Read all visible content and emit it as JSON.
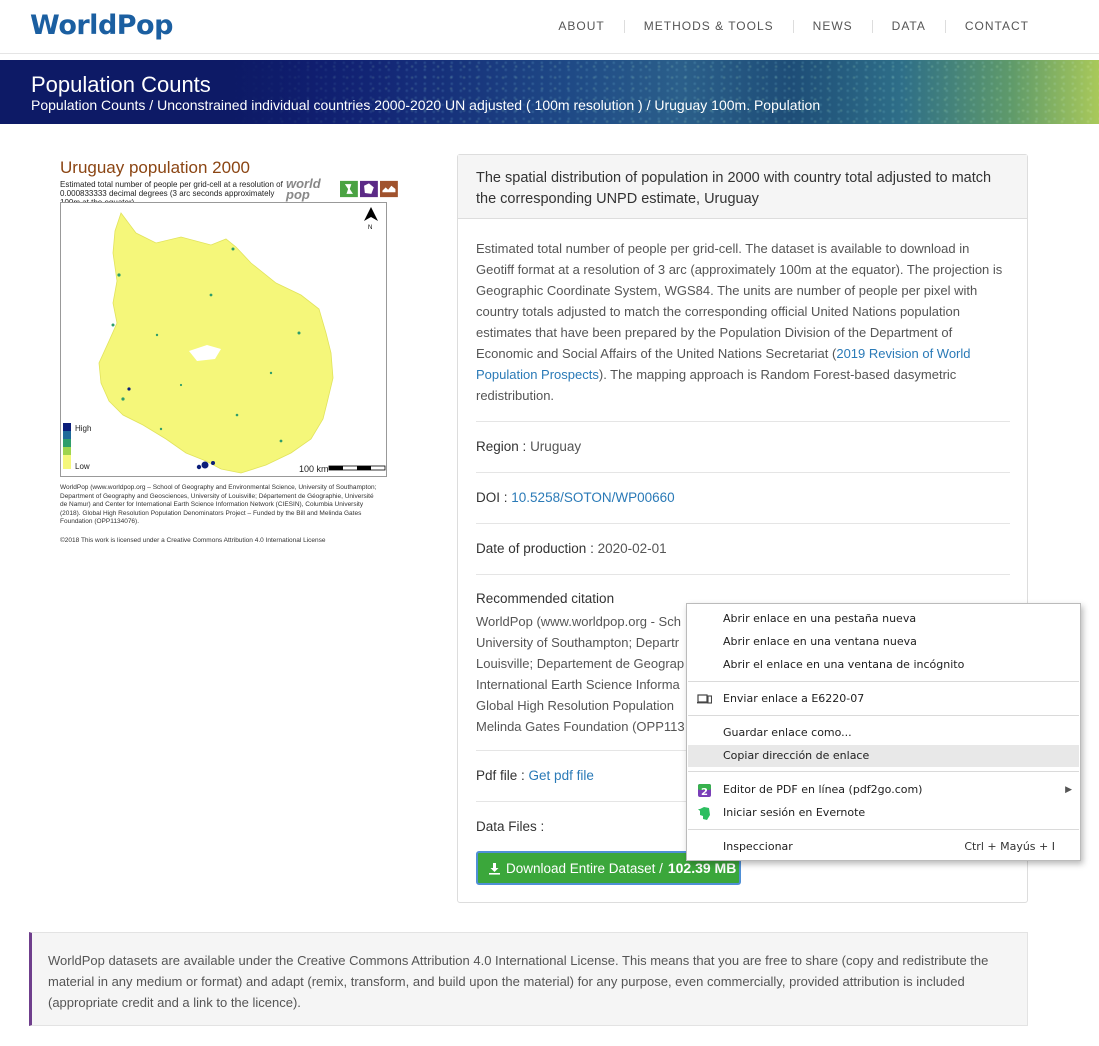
{
  "header": {
    "logo": "WorldPop",
    "nav": [
      "ABOUT",
      "METHODS & TOOLS",
      "NEWS",
      "DATA",
      "CONTACT"
    ]
  },
  "banner": {
    "title": "Population Counts",
    "breadcrumb": "Population Counts / Unconstrained individual countries 2000-2020 UN adjusted ( 100m resolution ) / Uruguay 100m. Population"
  },
  "figure": {
    "title": "Uruguay population 2000",
    "subtitle": "Estimated total number of people per grid-cell at a resolution of 0.000833333 decimal degrees (3 arc seconds approximately 100m at the equator)",
    "logo_text": "world pop",
    "north": "N",
    "legend_high": "High",
    "legend_low": "Low",
    "scale": "100 km",
    "credit": "WorldPop (www.worldpop.org – School of Geography and Environmental Science, University of Southampton; Department of Geography and Geosciences, University of Louisville; Département de Géographie, Université de Namur) and Center for International Earth Science Information Network (CIESIN), Columbia University (2018). Global High Resolution Population Denominators Project – Funded by the Bill and Melinda Gates Foundation (OPP1134076).",
    "license": "©2018 This work is licensed under a Creative Commons Attribution 4.0 International License",
    "colors": {
      "low": "#f5f77a",
      "high": "#0b1e7a",
      "mid": "#2f9d6b"
    }
  },
  "panel": {
    "heading": "The spatial distribution of population in 2000 with country total adjusted to match the corresponding UNPD estimate, Uruguay",
    "description_before": "Estimated total number of people per grid-cell. The dataset is available to download in Geotiff format at a resolution of 3 arc (approximately 100m at the equator). The projection is Geographic Coordinate System, WGS84. The units are number of people per pixel with country totals adjusted to match the corresponding official United Nations population estimates that have been prepared by the Population Division of the Department of Economic and Social Affairs of the United Nations Secretariat (",
    "description_link": "2019 Revision of World Population Prospects",
    "description_after": "). The mapping approach is Random Forest-based dasymetric redistribution.",
    "region_label": "Region :",
    "region_value": "Uruguay",
    "doi_label": "DOI :",
    "doi_value": "10.5258/SOTON/WP00660",
    "date_label": "Date of production :",
    "date_value": "2020-02-01",
    "citation_label": "Recommended citation",
    "citation_lines": [
      "WorldPop (www.worldpop.org - Sch",
      "University of Southampton; Departr",
      "Louisville; Departement de Geograp",
      "International Earth Science Informa",
      "Global High Resolution Population",
      "Melinda Gates Foundation (OPP113"
    ],
    "pdf_label": "Pdf file :",
    "pdf_link": "Get pdf file",
    "data_files_label": "Data Files :",
    "download_label": "Download Entire Dataset /",
    "download_size": "102.39 MB",
    "accent_color": "#3ba73b"
  },
  "license_box": {
    "text": "WorldPop datasets are available under the Creative Commons Attribution 4.0 International License. This means that you are free to share (copy and redistribute the material in any medium or format) and adapt (remix, transform, and build upon the material) for any purpose, even commercially, provided attribution is included (appropriate credit and a link to the licence)."
  },
  "context_menu": {
    "items": [
      {
        "label": "Abrir enlace en una pestaña nueva"
      },
      {
        "label": "Abrir enlace en una ventana nueva"
      },
      {
        "label": "Abrir el enlace en una ventana de incógnito"
      },
      {
        "label": "Enviar enlace a E6220-07",
        "icon": "device-icon"
      },
      {
        "label": "Guardar enlace como..."
      },
      {
        "label": "Copiar dirección de enlace",
        "highlighted": true
      },
      {
        "label": "Editor de PDF en línea (pdf2go.com)",
        "icon": "pdf2go-icon",
        "submenu": true
      },
      {
        "label": "Iniciar sesión en Evernote",
        "icon": "evernote-icon"
      },
      {
        "label": "Inspeccionar",
        "shortcut": "Ctrl + Mayús + I"
      }
    ]
  }
}
